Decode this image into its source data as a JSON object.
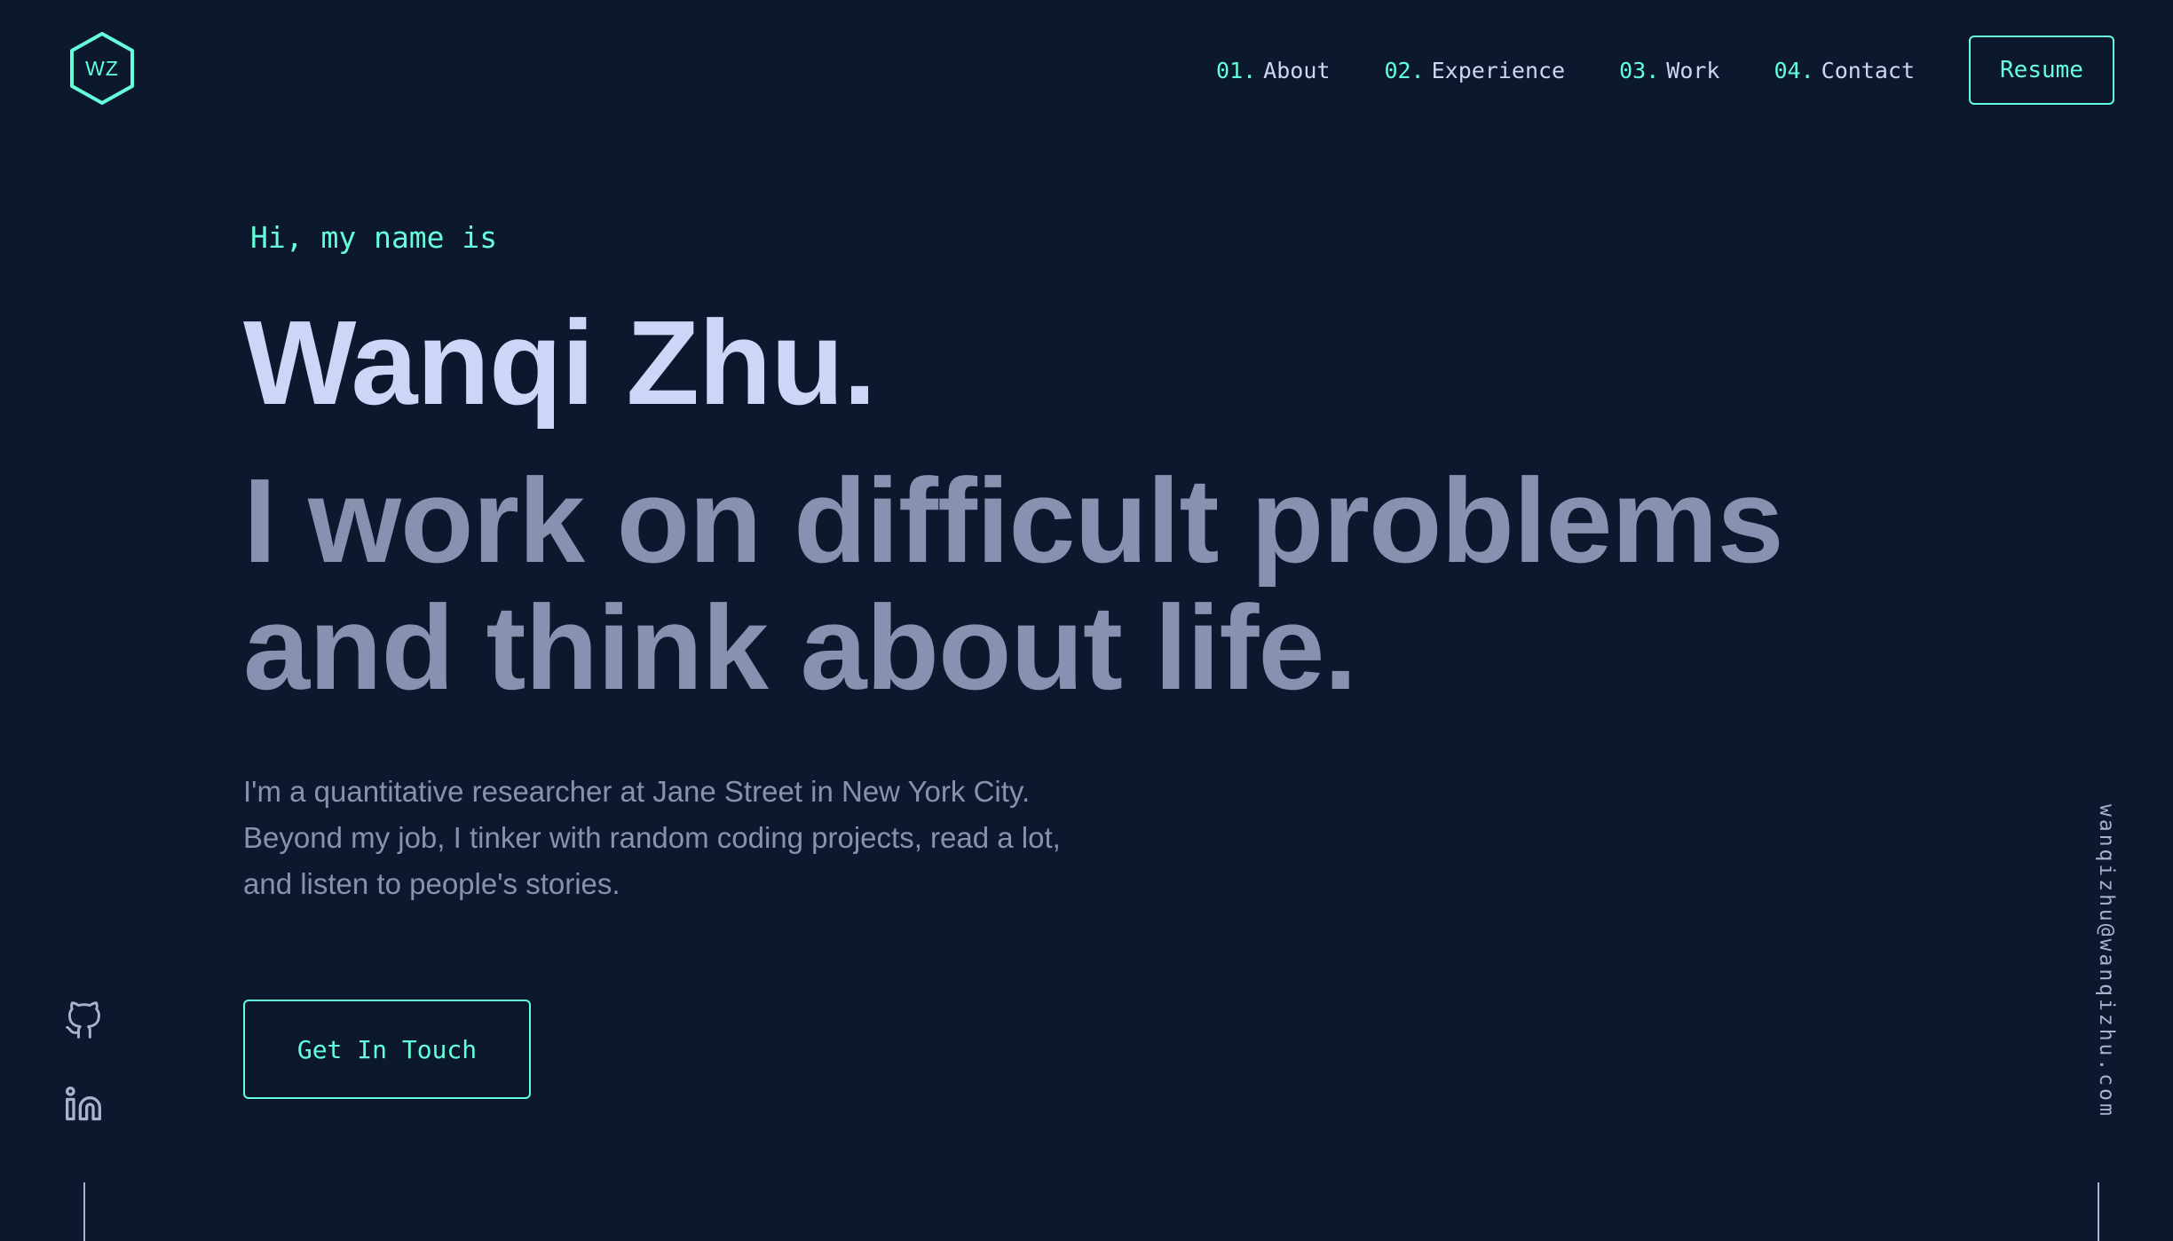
{
  "logo": {
    "initials": "WZ",
    "icon": "hexagon-logo-icon"
  },
  "nav": {
    "items": [
      {
        "num": "01.",
        "label": "About"
      },
      {
        "num": "02.",
        "label": "Experience"
      },
      {
        "num": "03.",
        "label": "Work"
      },
      {
        "num": "04.",
        "label": "Contact"
      }
    ],
    "resume_label": "Resume"
  },
  "hero": {
    "greeting": "Hi, my name is",
    "name": "Wanqi Zhu.",
    "tagline_line1": "I work on difficult problems",
    "tagline_line2": "and think about life.",
    "bio_line1": "I'm a quantitative researcher at Jane Street in New York City.",
    "bio_line2": "Beyond my job, I tinker with random coding projects, read a lot,",
    "bio_line3": "and listen to people's stories.",
    "cta_label": "Get In Touch"
  },
  "social": [
    {
      "icon": "github-icon"
    },
    {
      "icon": "linkedin-icon"
    }
  ],
  "email": "wanqizhu@wanqizhu.com",
  "colors": {
    "background": "#0c182d",
    "accent": "#64ffda",
    "heading": "#ccd6f6",
    "muted": "#8892b0",
    "light": "#a8b2d1"
  }
}
